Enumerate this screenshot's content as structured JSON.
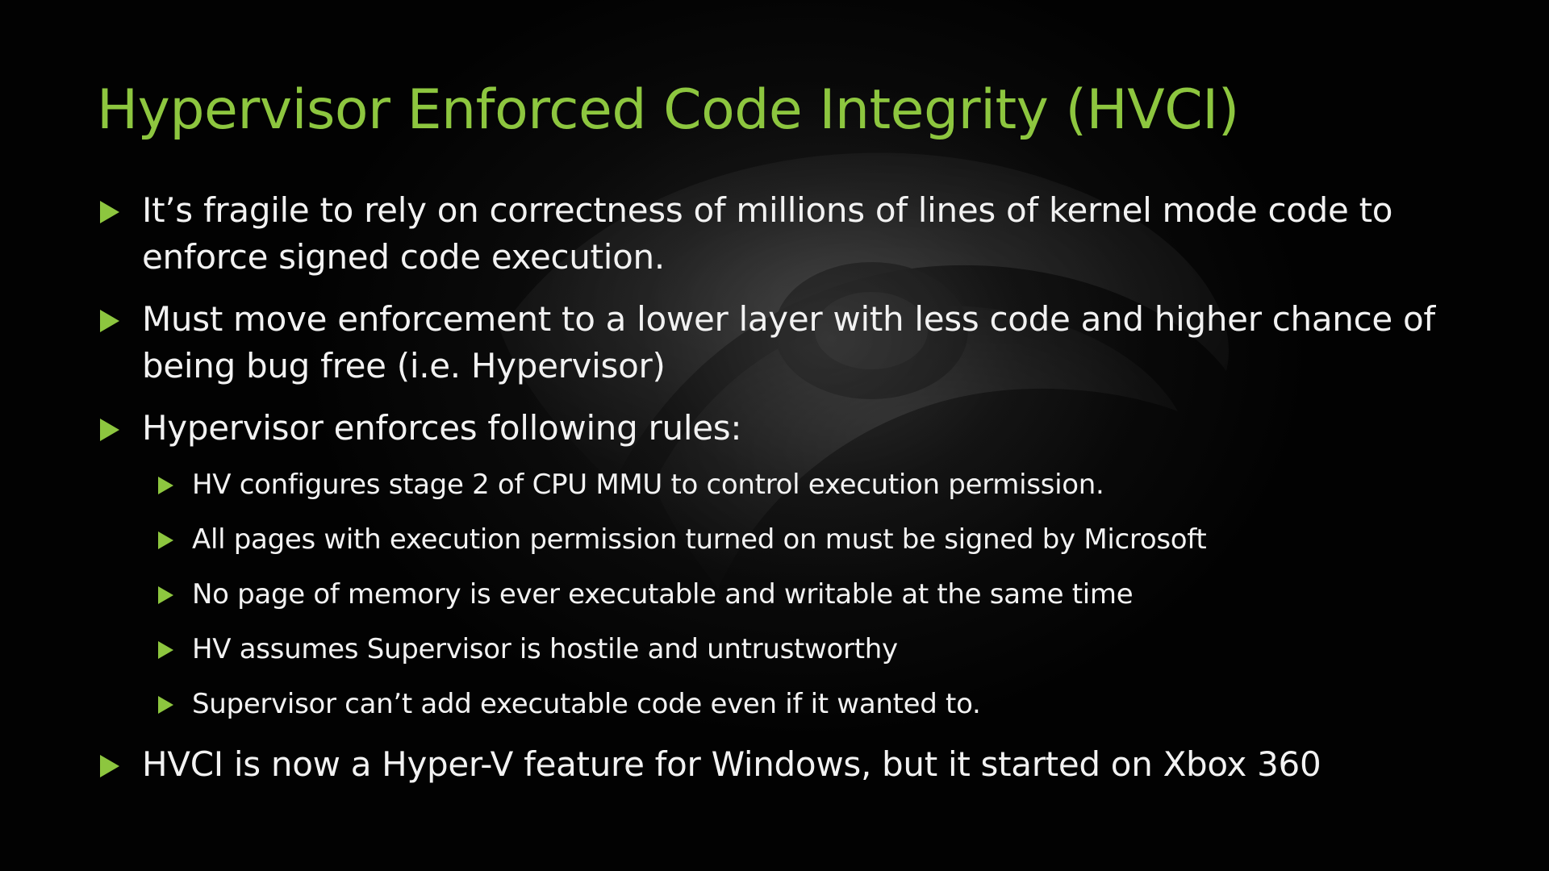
{
  "slide": {
    "title": "Hypervisor Enforced Code Integrity (HVCI)",
    "accent_color": "#8dc63f",
    "text_color": "#f2f2f2",
    "background_color": "#020202",
    "bullet_icon": "green-triangle-arrow-icon",
    "background_graphic": "faint-logo-graphic",
    "bullets": [
      {
        "text": "It’s fragile to rely on correctness of millions of lines of kernel mode code to enforce signed code execution."
      },
      {
        "text": "Must move enforcement to a lower layer with less code and higher chance of being bug free (i.e. Hypervisor)"
      },
      {
        "text": "Hypervisor enforces following rules:",
        "sub_bullets": [
          "HV configures stage 2 of CPU MMU to control execution permission.",
          "All pages with execution permission turned on must be signed by Microsoft",
          "No page of memory is ever executable and writable at the same time",
          "HV assumes Supervisor is hostile and untrustworthy",
          "Supervisor can’t add executable code even if it wanted to."
        ]
      },
      {
        "text": "HVCI is now a Hyper-V feature for Windows, but it started on Xbox 360"
      }
    ]
  }
}
